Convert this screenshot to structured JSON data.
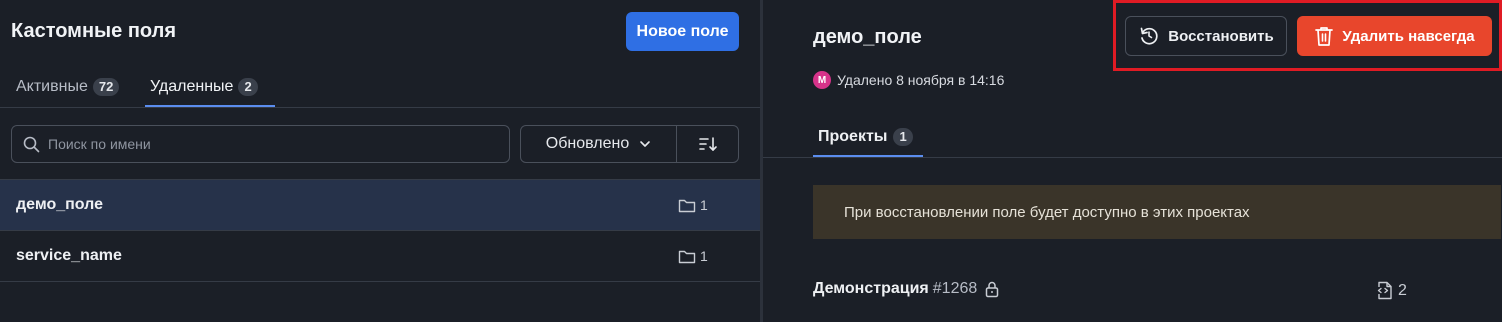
{
  "left_panel": {
    "title": "Кастомные поля",
    "new_button": "Новое поле",
    "tabs": [
      {
        "label": "Активные",
        "count": "72"
      },
      {
        "label": "Удаленные",
        "count": "2"
      }
    ],
    "search": {
      "placeholder": "Поиск по имени",
      "value": ""
    },
    "sort": {
      "selected": "Обновлено"
    },
    "fields": [
      {
        "name": "демо_поле",
        "projects": "1"
      },
      {
        "name": "service_name",
        "projects": "1"
      }
    ]
  },
  "right_panel": {
    "title": "демо_поле",
    "avatar_initial": "М",
    "deleted_text": "Удалено 8 ноября в 14:16",
    "restore_button": "Восстановить",
    "delete_button": "Удалить навсегда",
    "tab": {
      "label": "Проекты",
      "count": "1"
    },
    "notice": "При восстановлении поле будет доступно в этих проектах",
    "projects": [
      {
        "name": "Демонстрация",
        "id": "#1268",
        "usage": "2"
      }
    ]
  },
  "colors": {
    "accent_blue": "#2f6fe4",
    "danger": "#e8462c",
    "highlight": "#e01b24"
  }
}
